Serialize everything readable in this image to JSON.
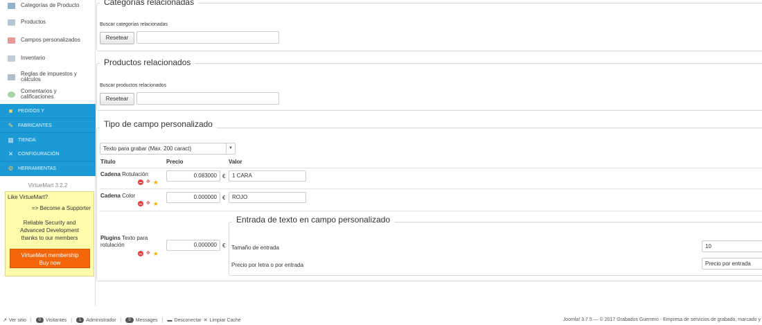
{
  "sidebar": {
    "items": [
      {
        "label": "Categorías de Producto",
        "icon": "folder-icon"
      },
      {
        "label": "Productos",
        "icon": "products-icon"
      },
      {
        "label": "Campos personalizados",
        "icon": "custom-fields-icon"
      },
      {
        "label": "Inventario",
        "icon": "inventory-icon"
      },
      {
        "label_line1": "Reglas de impuestos y",
        "label_line2": "cálculos",
        "icon": "calculator-icon"
      },
      {
        "label_line1": "Comentarios y",
        "label_line2": "calificaciones",
        "icon": "comment-icon"
      }
    ],
    "sections": [
      {
        "label": "PEDIDOS Y",
        "icon": "orders-icon"
      },
      {
        "label": "FABRICANTES",
        "icon": "wrench-icon"
      },
      {
        "label": "TIENDA",
        "icon": "shop-icon"
      },
      {
        "label": "CONFIGURACIÓN",
        "icon": "config-icon"
      },
      {
        "label": "HERRAMIENTAS",
        "icon": "tools-icon"
      }
    ],
    "version": "VirtueMart 3.2.2",
    "promo": {
      "line1": "Like VirtueMart?",
      "line2": "=> Become a Supporter",
      "line3": "Reliable Security and",
      "line4": "Advanced Development",
      "line5": "thanks to our members",
      "button_line1": "VirtueMart membership",
      "button_line2": "Buy now"
    }
  },
  "related_categories": {
    "legend": "Categorías relacionadas",
    "search_label": "Buscar categorías relacionadas",
    "reset_label": "Resetear",
    "search_value": ""
  },
  "related_products": {
    "legend": "Productos relacionados",
    "search_label": "Buscar productos relacionados",
    "reset_label": "Resetear",
    "search_value": ""
  },
  "custom_field_type": {
    "legend": "Tipo de campo personalizado",
    "selected": "Texto para grabar (Max. 200 caract)",
    "headers": {
      "title": "Título",
      "price": "Precio",
      "value": "Valor"
    },
    "currency": "€",
    "rows": [
      {
        "name": "Cadena",
        "label": "Rotulación",
        "price": "0.083000",
        "value": "1 CARA"
      },
      {
        "name": "Cadena",
        "label": "Color",
        "price": "0.000000",
        "value": "ROJO"
      },
      {
        "name": "Plugins",
        "label_line1": "Texto para",
        "label_line2": "rotulación",
        "price": "0.000000"
      }
    ]
  },
  "text_input_field": {
    "legend": "Entrada de texto en campo personalizado",
    "size_label": "Tamaño de entrada",
    "size_value": "10",
    "price_mode_label": "Precio por letra o por entrada",
    "price_mode_selected": "Precio por entrada"
  },
  "footer": {
    "view_site": "Ver sitio",
    "visitors_count": "0",
    "visitors": "Visitantes",
    "admin_count": "1",
    "admin": "Administrador",
    "messages_count": "0",
    "messages": "Messages",
    "logout": "Desconectar",
    "clear_cache": "Limpiar Caché",
    "copyright": "Joomla! 3.7.5 — © 2017 Grabados Guerrero - Empresa de servicios de grabado, marcado y"
  },
  "colors": {
    "sidebar_blue": "#1b9ad6",
    "promo_bg": "#fffcab",
    "promo_button": "#f4660a"
  }
}
